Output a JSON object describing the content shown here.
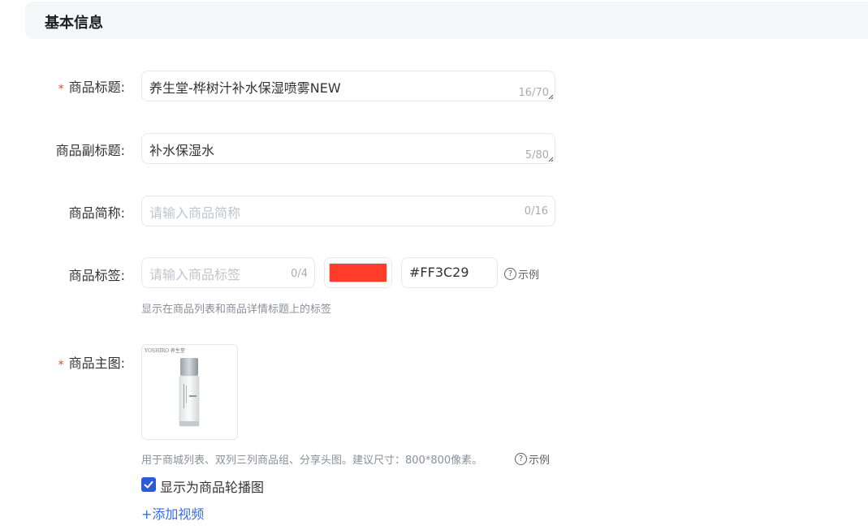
{
  "section": {
    "title": "基本信息"
  },
  "required_mark": "*",
  "fields": {
    "title": {
      "label": "商品标题:",
      "value": "养生堂-桦树汁补水保湿喷雾NEW",
      "counter": "16/70"
    },
    "subtitle": {
      "label": "商品副标题:",
      "value": "补水保湿水",
      "counter": "5/80"
    },
    "short_name": {
      "label": "商品简称:",
      "placeholder": "请输入商品简称",
      "counter": "0/16"
    },
    "tag": {
      "label": "商品标签:",
      "placeholder": "请输入商品标签",
      "counter": "0/4",
      "color_value": "#FF3C29",
      "color": "#FF3C29",
      "example_label": "示例",
      "hint": "显示在商品列表和商品详情标题上的标签"
    },
    "main_image": {
      "label": "商品主图:",
      "brand_text": "YOSHIRO 养生堂",
      "hint": "用于商城列表、双列三列商品组、分享头图。建议尺寸：800*800像素。",
      "example_label": "示例",
      "checkbox_label": "显示为商品轮播图",
      "checkbox_checked": true,
      "add_video_label": "+添加视频"
    }
  },
  "colors": {
    "accent": "#2d5bd8",
    "link": "#3b6ddc",
    "required": "#e5461a"
  }
}
